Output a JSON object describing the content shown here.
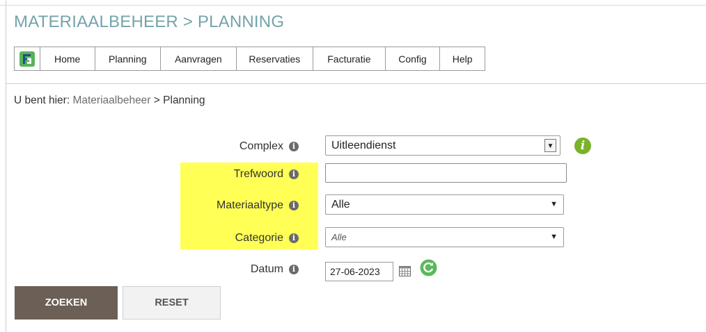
{
  "header": {
    "title": "MATERIAALBEHEER > PLANNING"
  },
  "nav": {
    "logo_icon": "fb-logo-icon",
    "items": [
      {
        "label": "Home"
      },
      {
        "label": "Planning"
      },
      {
        "label": "Aanvragen"
      },
      {
        "label": "Reservaties"
      },
      {
        "label": "Facturatie"
      },
      {
        "label": "Config"
      },
      {
        "label": "Help"
      }
    ]
  },
  "breadcrumb": {
    "prefix": "U bent hier:",
    "link": "Materiaalbeheer",
    "separator": ">",
    "current": "Planning"
  },
  "form": {
    "complex": {
      "label": "Complex",
      "value": "Uitleendienst"
    },
    "trefwoord": {
      "label": "Trefwoord",
      "value": ""
    },
    "materiaaltype": {
      "label": "Materiaaltype",
      "value": "Alle"
    },
    "categorie": {
      "label": "Categorie",
      "value": "Alle"
    },
    "datum": {
      "label": "Datum",
      "value": "27-06-2023"
    }
  },
  "buttons": {
    "search": "ZOEKEN",
    "reset": "RESET"
  },
  "colors": {
    "title": "#74a3ab",
    "highlight": "#ffff55",
    "search_button": "#6b5f56",
    "info_green": "#7ab22a"
  }
}
